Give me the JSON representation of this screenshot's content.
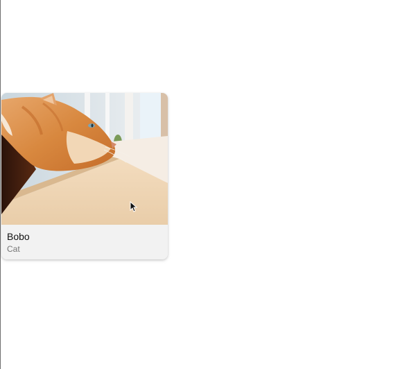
{
  "card": {
    "title": "Bobo",
    "subtitle": "Cat",
    "image": "orange-cat-at-window-photo"
  },
  "cursor": {
    "icon": "arrow-pointer-icon"
  }
}
